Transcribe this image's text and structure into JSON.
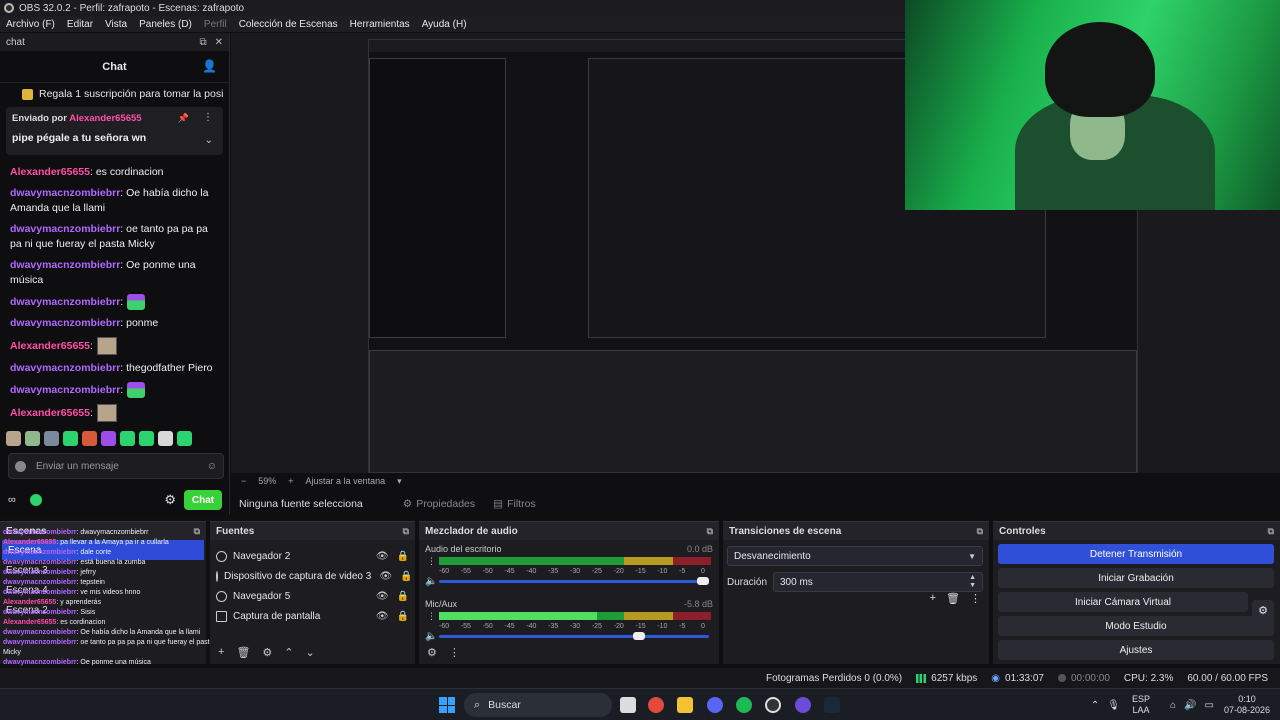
{
  "window": {
    "title": "OBS 32.0.2 - Perfil: zafrapoto - Escenas: zafrapoto"
  },
  "menu": [
    "Archivo (F)",
    "Editar",
    "Vista",
    "Paneles (D)",
    "Perfil",
    "Colección de Escenas",
    "Herramientas",
    "Ayuda (H)"
  ],
  "chat": {
    "dock_title": "chat",
    "header": "Chat",
    "promo": "Regala 1 suscripción para tomar la posi",
    "pinned": {
      "sent_by": "Enviado por",
      "author": "Alexander65655",
      "text": "pipe pégale a tu señora wn"
    },
    "messages": [
      {
        "user": "Alexander65655",
        "color": "pink",
        "text": ": es cordinacion"
      },
      {
        "user": "dwavymacnzombiebrr",
        "color": "purple",
        "text": ": Oe había dicho la Amanda que la llami"
      },
      {
        "user": "dwavymacnzombiebrr",
        "color": "purple",
        "text": ": oe tanto pa pa pa pa ni que fueray el pasta Micky"
      },
      {
        "user": "dwavymacnzombiebrr",
        "color": "purple",
        "text": ": Oe ponme una música"
      },
      {
        "user": "dwavymacnzombiebrr",
        "color": "purple",
        "text": ":",
        "emote": "chair"
      },
      {
        "user": "dwavymacnzombiebrr",
        "color": "purple",
        "text": ": ponme"
      },
      {
        "user": "Alexander65655",
        "color": "pink",
        "text": ":",
        "emote": "face"
      },
      {
        "user": "dwavymacnzombiebrr",
        "color": "purple",
        "text": ": thegodfather Piero"
      },
      {
        "user": "dwavymacnzombiebrr",
        "color": "purple",
        "text": ":",
        "emote": "chair"
      },
      {
        "user": "Alexander65655",
        "color": "pink",
        "text": ":",
        "emote": "face"
      }
    ],
    "input_placeholder": "Enviar un mensaje",
    "points": "∞",
    "send_label": "Chat"
  },
  "zoom": {
    "minus": "−",
    "value": "59%",
    "plus": "+",
    "fit": "Ajustar a la ventana"
  },
  "source_toolbar": {
    "no_source": "Ninguna fuente selecciona",
    "properties": "Propiedades",
    "filters": "Filtros"
  },
  "scenes": {
    "title": "Escenas",
    "items": [
      "Escena",
      "Escena 3",
      "Escena 4",
      "Escena 2"
    ]
  },
  "overlay_chat": [
    [
      "dwavymacnzombiebrr",
      "v",
      ": dwavymacnzombiebrr"
    ],
    [
      "Alexander65655",
      "p",
      ": pa llevar a la Amaya pa ir a cullarla"
    ],
    [
      "dwavymacnzombiebrr",
      "v",
      ": dale corte"
    ],
    [
      "dwavymacnzombiebrr",
      "v",
      ": está buena la zumba"
    ],
    [
      "dwavymacnzombiebrr",
      "v",
      ": jefrry"
    ],
    [
      "dwavymacnzombiebrr",
      "v",
      ": tepstein"
    ],
    [
      "dwavymacnzombiebrr",
      "v",
      ": ve mis videos hnno"
    ],
    [
      "Alexander65655",
      "p",
      ": y aprenderás"
    ],
    [
      "dwavymacnzombiebrr",
      "v",
      ": Sisis"
    ],
    [
      "Alexander65655",
      "p",
      ": es cordinacion"
    ],
    [
      "dwavymacnzombiebrr",
      "v",
      ": Oe había dicho la Amanda que la llami"
    ],
    [
      "dwavymacnzombiebrr",
      "v",
      ": oe tanto pa pa pa pa ni que fueray el pasta Micky"
    ],
    [
      "dwavymacnzombiebrr",
      "v",
      ": Oe ponme una música"
    ],
    [
      "dwavymacnzombiebrr",
      "v",
      ":"
    ],
    [
      "dwavymacnzombiebrr",
      "v",
      ": ponme"
    ],
    [
      "Alexander65655",
      "p",
      ":"
    ],
    [
      "dwavymacnzombiebrr",
      "v",
      ": thegodfather Piero"
    ],
    [
      "dwavymacnzombiebrr",
      "v",
      ":"
    ],
    [
      "Alexander65655",
      "p",
      ":"
    ]
  ],
  "sources": {
    "title": "Fuentes",
    "items": [
      {
        "label": "Navegador 2",
        "icon": "globe-icon"
      },
      {
        "label": "Dispositivo de captura de video 3",
        "icon": "camera-icon"
      },
      {
        "label": "Navegador 5",
        "icon": "globe-icon"
      },
      {
        "label": "Captura de pantalla",
        "icon": "monitor-icon"
      }
    ]
  },
  "mixer": {
    "title": "Mezclador de audio",
    "ticks": [
      "-60",
      "-55",
      "-50",
      "-45",
      "-40",
      "-35",
      "-30",
      "-25",
      "-20",
      "-15",
      "-10",
      "-5",
      "0"
    ],
    "channels": [
      {
        "name": "Audio del escritorio",
        "db": "0.0 dB",
        "level": 0.0,
        "volume": 1.0
      },
      {
        "name": "Mic/Aux",
        "db": "-5.8 dB",
        "level": 0.58,
        "volume": 0.75
      }
    ]
  },
  "transitions": {
    "title": "Transiciones de escena",
    "selected": "Desvanecimiento",
    "duration_label": "Duración",
    "duration": "300 ms"
  },
  "controls": {
    "title": "Controles",
    "buttons": [
      "Detener Transmisión",
      "Iniciar Grabación",
      "Iniciar Cámara Virtual",
      "Modo Estudio",
      "Ajustes"
    ]
  },
  "status": {
    "dropped": "Fotogramas Perdidos 0 (0.0%)",
    "bitrate": "6257 kbps",
    "stream_time": "01:33:07",
    "rec_time": "00:00:00",
    "cpu": "CPU: 2.3%",
    "fps": "60.00 / 60.00 FPS"
  },
  "taskbar": {
    "search": "Buscar",
    "lang_top": "ESP",
    "lang_bottom": "LAA",
    "time": "0:10",
    "date": "07-08-2026"
  },
  "colors": {
    "accent": "#3050d8",
    "chat_button": "#38d13a",
    "user_pink": "#ff4fa8",
    "user_purple": "#b267ff"
  }
}
